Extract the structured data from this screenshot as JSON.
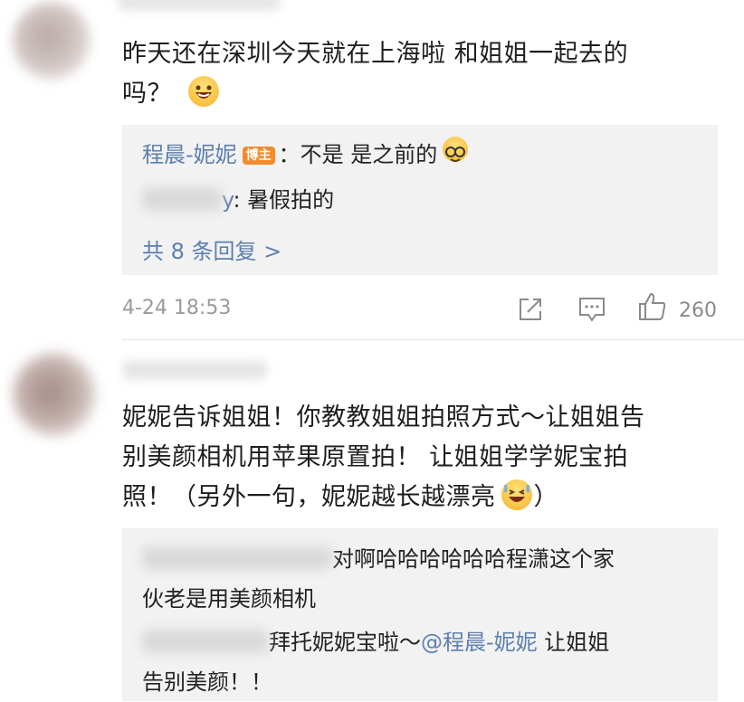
{
  "comment1": {
    "text_line1": "昨天还在深圳今天就在上海啦 和姐姐一起去的",
    "text_line2": "吗？",
    "emoji": "laughing-emoji",
    "replies": [
      {
        "author": "程晨-妮妮",
        "badge": "博主",
        "text": "：不是 是之前的",
        "emoji": "nerd-emoji"
      },
      {
        "author_suffix": "y",
        "text": ": 暑假拍的"
      }
    ],
    "more_replies": "共 8 条回复 >",
    "timestamp": "4-24 18:53",
    "like_count": "260"
  },
  "comment2": {
    "text_line1": "妮妮告诉姐姐！你教教姐姐拍照方式～让姐姐告",
    "text_line2": "别美颜相机用苹果原置拍！ 让姐姐学学妮宝拍",
    "text_line3a": "照！（另外一句，妮妮越长越漂亮",
    "text_line3b": "）",
    "emoji": "grinning-sweat-emoji",
    "replies": [
      {
        "text_line1": "对啊哈哈哈哈哈哈程潇这个家",
        "text_line2": "伙老是用美颜相机"
      },
      {
        "text_before": "拜托妮妮宝啦～",
        "mention": "@程晨-妮妮",
        "text_after": " 让姐姐",
        "text_line2": "告别美颜！！"
      }
    ]
  },
  "colors": {
    "link": "#5c7fb0",
    "badge": "#f28a2e",
    "reply_bg": "#f2f2f2",
    "meta": "#9a9a9a"
  }
}
